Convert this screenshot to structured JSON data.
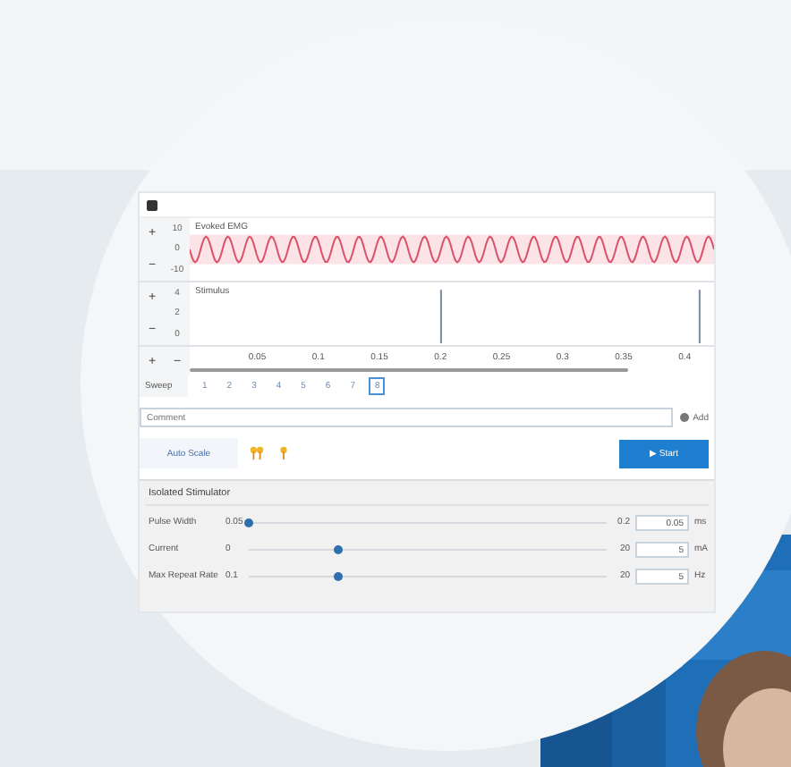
{
  "traces": [
    {
      "kind": "wave",
      "title": "Evoked EMG",
      "yticks": [
        "10",
        "0",
        "-10"
      ]
    },
    {
      "kind": "pulses",
      "title": "Stimulus",
      "yticks": [
        "4",
        "2",
        "0"
      ]
    }
  ],
  "xticks": [
    "0.05",
    "0.1",
    "0.15",
    "0.2",
    "0.25",
    "0.3",
    "0.35",
    "0.4"
  ],
  "zoom_buttons": [
    "+",
    "−"
  ],
  "sweep": {
    "label": "Sweep",
    "items": [
      {
        "label": "1",
        "selected": false
      },
      {
        "label": "2",
        "selected": false
      },
      {
        "label": "3",
        "selected": false
      },
      {
        "label": "4",
        "selected": false
      },
      {
        "label": "5",
        "selected": false
      },
      {
        "label": "6",
        "selected": false
      },
      {
        "label": "7",
        "selected": false
      },
      {
        "label": "8",
        "selected": true
      }
    ]
  },
  "comment": {
    "placeholder": "Comment",
    "button": "Add"
  },
  "toolbar": {
    "auto_scale": "Auto Scale",
    "start": "▶ Start"
  },
  "stimulator": {
    "title": "Isolated Stimulator",
    "rows": [
      {
        "label": "Pulse Width",
        "min": "0.05",
        "max": "0.2",
        "level": 0,
        "value": "0.05",
        "unit": "ms"
      },
      {
        "label": "Current",
        "min": "0",
        "max": "20",
        "level": 0.25,
        "value": "5",
        "unit": "mA"
      },
      {
        "label": "Max Repeat Rate",
        "min": "0.1",
        "max": "20",
        "level": 0.25,
        "value": "5",
        "unit": "Hz"
      }
    ]
  },
  "background": {
    "kind": "picture"
  }
}
